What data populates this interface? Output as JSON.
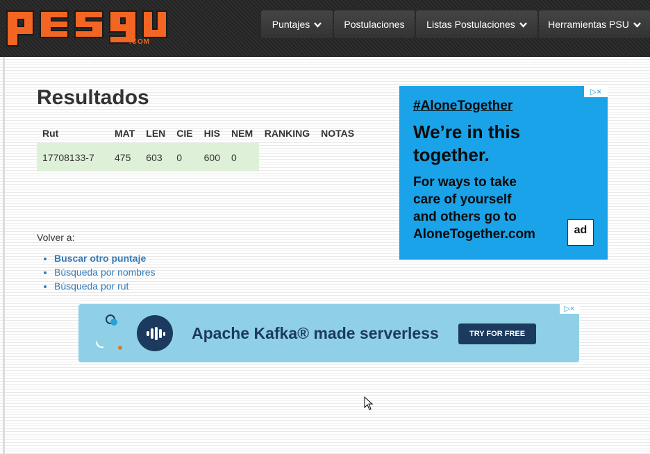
{
  "header": {
    "logo_text": "pes9u",
    "logo_suffix": ".COM",
    "nav": [
      {
        "label": "Puntajes",
        "dropdown": true
      },
      {
        "label": "Postulaciones",
        "dropdown": false
      },
      {
        "label": "Listas Postulaciones",
        "dropdown": true
      },
      {
        "label": "Herramientas PSU",
        "dropdown": true
      }
    ]
  },
  "main": {
    "title": "Resultados",
    "table": {
      "headers": [
        "Rut",
        "MAT",
        "LEN",
        "CIE",
        "HIS",
        "NEM",
        "RANKING",
        "NOTAS"
      ],
      "rows": [
        [
          "17708133-7",
          "475",
          "603",
          "0",
          "600",
          "0",
          "",
          ""
        ]
      ]
    },
    "volver_label": "Volver a:",
    "links": [
      {
        "label": "Buscar otro puntaje",
        "bold": true
      },
      {
        "label": "Búsqueda por nombres",
        "bold": false
      },
      {
        "label": "Búsqueda por rut",
        "bold": false
      }
    ]
  },
  "ad_side": {
    "hashtag": "#AloneTogether",
    "headline_1": "We’re in this",
    "headline_2": "together.",
    "body_1": "For ways to take",
    "body_2": "care of yourself",
    "body_3": "and others go to",
    "body_4": "AloneTogether.com",
    "logo_text": "ad",
    "corner": "▷×",
    "bg_color": "#1aa3e8"
  },
  "ad_banner": {
    "text": "Apache Kafka® made serverless",
    "cta": "TRY FOR FREE",
    "corner": "▷×",
    "bg_color": "#8fd0e6"
  },
  "colors": {
    "brand_orange": "#f26522",
    "link": "#337ab7",
    "row_highlight": "#dff0d8"
  }
}
